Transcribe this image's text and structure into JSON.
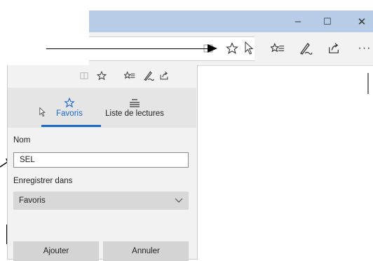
{
  "browser": {
    "window_controls": {
      "minimize": "–",
      "maximize": "☐",
      "close": "✕"
    },
    "toolbar": {
      "icons": [
        "reading-view-icon",
        "star-icon",
        "cursor-icon",
        "favorites-hub-icon",
        "pen-icon",
        "share-icon",
        "more-icon"
      ],
      "more_label": "···"
    }
  },
  "flyout": {
    "tabs": [
      {
        "label": "Favoris",
        "icon": "star-icon",
        "active": true
      },
      {
        "label": "Liste de lectures",
        "icon": "reading-list-icon",
        "active": false
      }
    ],
    "name_label": "Nom",
    "name_value": "SEL",
    "save_in_label": "Enregistrer dans",
    "save_in_value": "Favoris",
    "add_button": "Ajouter",
    "cancel_button": "Annuler"
  },
  "colors": {
    "titlebar": "#b7cde7",
    "accent": "#1a69c7",
    "panel_bg": "#f2f2f2",
    "tabs_bg": "#e5e5e5",
    "button_bg": "#d4d4d4"
  }
}
